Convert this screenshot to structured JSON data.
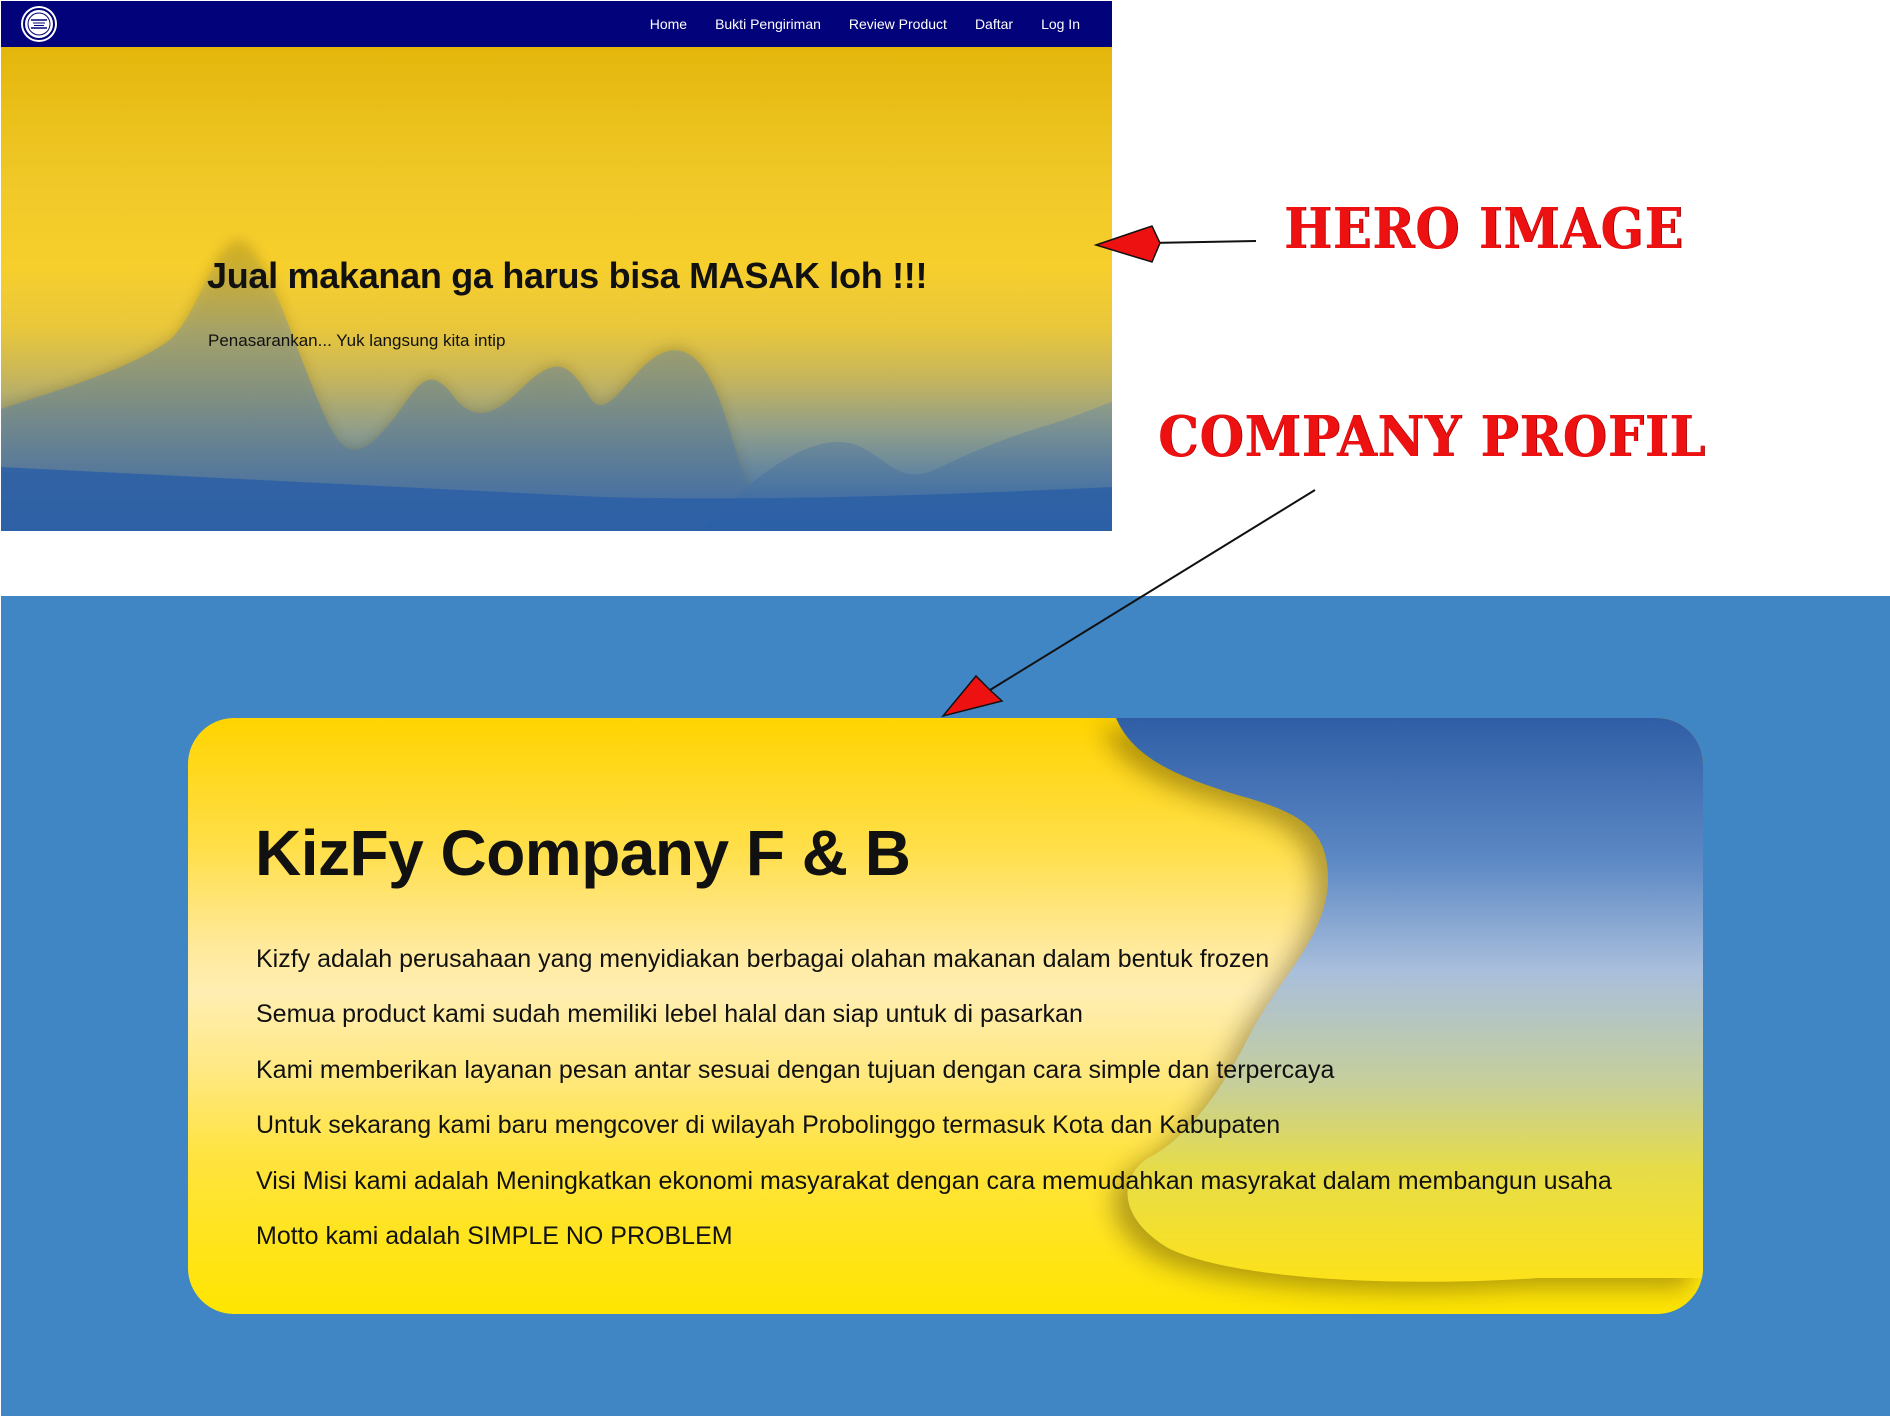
{
  "hero_screen": {
    "nav": {
      "logo_text": "KIZFY",
      "links": [
        "Home",
        "Bukti Pengiriman",
        "Review Product",
        "Daftar",
        "Log In"
      ]
    },
    "hero": {
      "title": "Jual makanan ga harus bisa MASAK loh !!!",
      "subtitle": "Penasarankan... Yuk langsung kita intip"
    }
  },
  "annotations": {
    "hero_label": "HERO IMAGE",
    "company_label": "COMPANY PROFIL"
  },
  "company_screen": {
    "title": "KizFy Company F & B",
    "lines": [
      "Kizfy adalah perusahaan yang menyidiakan berbagai olahan makanan dalam bentuk frozen",
      "Semua product kami sudah memiliki lebel halal dan siap untuk di pasarkan",
      "Kami memberikan layanan pesan antar sesuai dengan tujuan dengan cara simple dan terpercaya",
      "Untuk sekarang kami baru mengcover di wilayah Probolinggo termasuk Kota dan Kabupaten",
      "Visi Misi kami adalah Meningkatkan ekonomi masyarakat dengan cara memudahkan masyrakat dalam membangun usaha",
      "Motto kami adalah SIMPLE NO PROBLEM"
    ]
  },
  "colors": {
    "navbar": "#02027a",
    "hero_yellow": "#f3c21c",
    "hero_blue": "#2f62a6",
    "section_blue": "#4086c4",
    "card_yellow": "#ffd400",
    "annotation_red": "#ee1111"
  }
}
